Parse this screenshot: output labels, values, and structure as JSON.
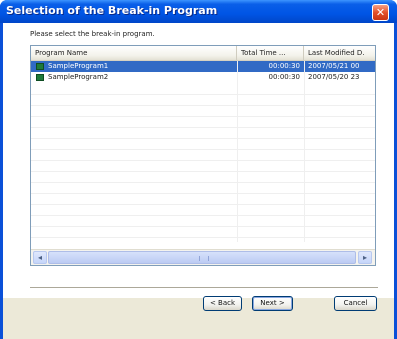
{
  "window": {
    "title": "Selection of the Break-in Program",
    "close_glyph": "✕"
  },
  "prompt": "Please select the break-in program.",
  "list": {
    "columns": [
      "Program Name",
      "Total Time ...",
      "Last Modified D."
    ],
    "rows": [
      {
        "name": "SampleProgram1",
        "total_time": "00:00:30",
        "last_modified": "2007/05/21 00",
        "selected": true,
        "icon": "program-icon"
      },
      {
        "name": "SampleProgram2",
        "total_time": "00:00:30",
        "last_modified": "2007/05/20 23",
        "selected": false,
        "icon": "program-icon"
      }
    ]
  },
  "scrollbar": {
    "left_glyph": "◂",
    "right_glyph": "▸"
  },
  "buttons": {
    "back": "< Back",
    "next": "Next >",
    "cancel": "Cancel"
  },
  "colors": {
    "title_bar": "#0055e5",
    "selection": "#316ac5",
    "dialog_bg": "#ece9d8",
    "close_button": "#e4502a"
  }
}
